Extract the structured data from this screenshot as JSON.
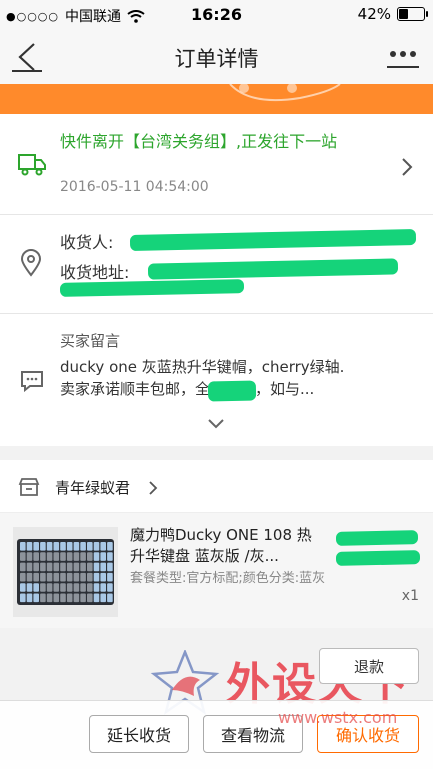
{
  "status_bar": {
    "carrier": "中国联通",
    "time": "16:26",
    "battery": "42%",
    "battery_level": 0.42
  },
  "nav": {
    "title": "订单详情"
  },
  "logistics": {
    "status": "快件离开【台湾关务组】,正发往下一站",
    "time": "2016-05-11 04:54:00"
  },
  "address": {
    "receiver_label": "收货人:",
    "address_label": "收货地址:"
  },
  "message": {
    "title": "买家留言",
    "line1": "ducky one 灰蓝热升华键帽，cherry绿轴.",
    "line2": "卖家承诺顺丰包邮，全新正品，如与..."
  },
  "shop": {
    "name": "青年绿蚁君"
  },
  "product": {
    "title": "魔力鸭Ducky ONE 108 热升华键盘 蓝灰版 /灰...",
    "sku": "套餐类型:官方标配;颜色分类:蓝灰",
    "quantity": "x1"
  },
  "actions": {
    "refund": "退款",
    "extend": "延长收货",
    "logistics": "查看物流",
    "confirm": "确认收货"
  },
  "watermark": {
    "text": "外设天下",
    "url": "www.wstx.com"
  },
  "colors": {
    "accent": "#ff6a00",
    "logistics_green": "#2da52d",
    "banner_orange": "#ff8a2b"
  }
}
